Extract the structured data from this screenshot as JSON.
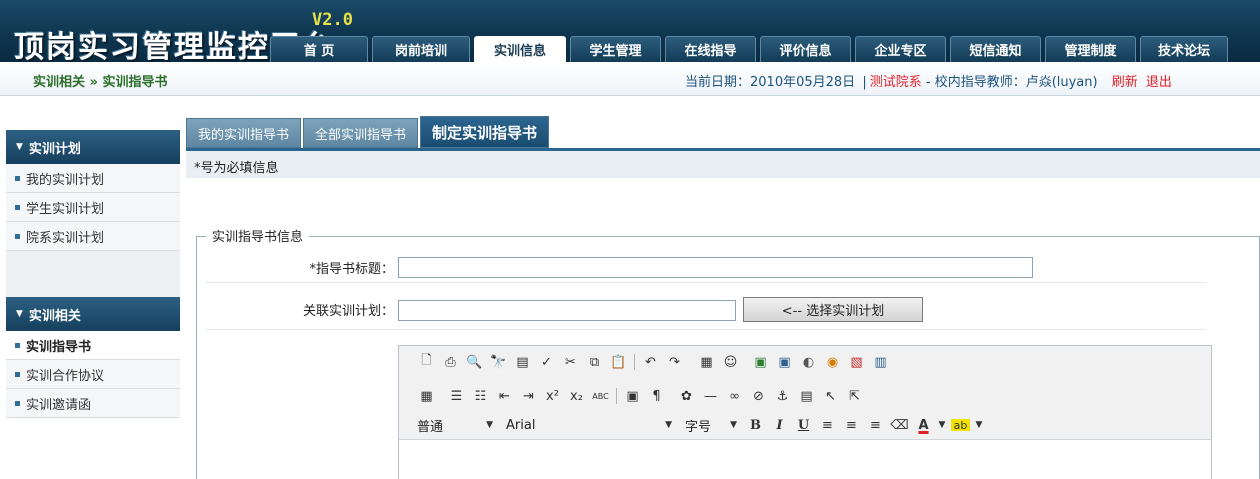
{
  "header": {
    "title": "顶岗实习管理监控平台",
    "version": "V2.0",
    "nav": [
      "首 页",
      "岗前培训",
      "实训信息",
      "学生管理",
      "在线指导",
      "评价信息",
      "企业专区",
      "短信通知",
      "管理制度",
      "技术论坛"
    ],
    "active_nav": "实训信息"
  },
  "infobar": {
    "breadcrumb": "实训相关 » 实训指导书",
    "date_label": "当前日期：",
    "date_value": "2010年05月28日",
    "separator": "|",
    "dept": "测试院系",
    "role_text": " - 校内指导教师：卢焱(luyan)",
    "refresh": "刷新",
    "logout": "退出"
  },
  "sidebar": {
    "sections": [
      {
        "title": "实训计划",
        "items": [
          "我的实训计划",
          "学生实训计划",
          "院系实训计划"
        ]
      },
      {
        "title": "实训相关",
        "items": [
          "实训指导书",
          "实训合作协议",
          "实训邀请函"
        ]
      }
    ],
    "active_item": "实训指导书"
  },
  "content": {
    "tabs": [
      "我的实训指导书",
      "全部实训指导书",
      "制定实训指导书"
    ],
    "active_tab": "制定实训指导书",
    "required_note": "*号为必填信息",
    "legend": "实训指导书信息",
    "title_label": "*指导书标题：",
    "title_value": "",
    "plan_label": "关联实训计划：",
    "plan_value": "",
    "pick_button": "<-- 选择实训计划"
  },
  "editor": {
    "format_select": "普通",
    "font_select": "Arial",
    "size_select": "字号",
    "row1_icons": [
      "new-doc-icon",
      "print-icon",
      "preview-icon",
      "find-icon",
      "save-icon",
      "spellcheck-icon",
      "cut-icon",
      "copy-icon",
      "paste-icon",
      "undo-icon",
      "redo-icon",
      "insert-table-icon",
      "emoticon-icon",
      "image-icon",
      "picture-icon",
      "flash-icon",
      "media-icon",
      "pdf-icon",
      "form-icon"
    ],
    "row2_icons": [
      "table-icon",
      "ordered-list-icon",
      "unordered-list-icon",
      "outdent-icon",
      "indent-icon",
      "superscript-icon",
      "subscript-icon",
      "spell-icon",
      "paste-word-icon",
      "paragraph-icon",
      "special-char-icon",
      "horizontal-rule-icon",
      "link-icon",
      "unlink-icon",
      "anchor-icon",
      "page-break-icon",
      "cursor-icon",
      "select-icon"
    ],
    "row3_icons": [
      "bold-icon",
      "italic-icon",
      "underline-icon",
      "align-left-icon",
      "align-center-icon",
      "align-right-icon",
      "eraser-icon",
      "font-color-icon",
      "highlight-icon"
    ],
    "colors": {
      "font_color": "#e0202a",
      "highlight": "#f2e200"
    }
  }
}
